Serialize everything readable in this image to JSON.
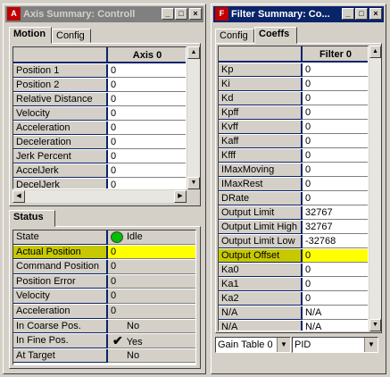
{
  "left_window": {
    "title": "Axis Summary: Controll",
    "motion_tabs": [
      "Motion",
      "Config"
    ],
    "motion_column_header": "Axis 0",
    "motion_rows": [
      {
        "label": "Position 1",
        "value": "0"
      },
      {
        "label": "Position 2",
        "value": "0"
      },
      {
        "label": "Relative Distance",
        "value": "0"
      },
      {
        "label": "Velocity",
        "value": "0"
      },
      {
        "label": "Acceleration",
        "value": "0"
      },
      {
        "label": "Deceleration",
        "value": "0"
      },
      {
        "label": "Jerk Percent",
        "value": "0"
      },
      {
        "label": "AccelJerk",
        "value": "0"
      },
      {
        "label": "DecelJerk",
        "value": "0"
      }
    ],
    "status_tab": "Status",
    "status_rows": [
      {
        "label": "State",
        "value": "Idle"
      },
      {
        "label": "Actual Position",
        "value": "0"
      },
      {
        "label": "Command Position",
        "value": "0"
      },
      {
        "label": "Position Error",
        "value": "0"
      },
      {
        "label": "Velocity",
        "value": "0"
      },
      {
        "label": "Acceleration",
        "value": "0"
      },
      {
        "label": "In Coarse Pos.",
        "value": "No"
      },
      {
        "label": "In Fine Pos.",
        "value": "Yes"
      },
      {
        "label": "At Target",
        "value": "No"
      }
    ],
    "state_indicator_color": "#00c000"
  },
  "right_window": {
    "title": "Filter Summary: Co...",
    "tabs": [
      "Config",
      "Coeffs"
    ],
    "column_header": "Filter 0",
    "rows": [
      {
        "label": "Kp",
        "value": "0"
      },
      {
        "label": "Ki",
        "value": "0"
      },
      {
        "label": "Kd",
        "value": "0"
      },
      {
        "label": "Kpff",
        "value": "0"
      },
      {
        "label": "Kvff",
        "value": "0"
      },
      {
        "label": "Kaff",
        "value": "0"
      },
      {
        "label": "Kfff",
        "value": "0"
      },
      {
        "label": "IMaxMoving",
        "value": "0"
      },
      {
        "label": "IMaxRest",
        "value": "0"
      },
      {
        "label": "DRate",
        "value": "0"
      },
      {
        "label": "Output Limit",
        "value": "32767"
      },
      {
        "label": "Output Limit High",
        "value": "32767"
      },
      {
        "label": "Output Limit Low",
        "value": "-32768"
      },
      {
        "label": "Output Offset",
        "value": "0"
      },
      {
        "label": "Ka0",
        "value": "0"
      },
      {
        "label": "Ka1",
        "value": "0"
      },
      {
        "label": "Ka2",
        "value": "0"
      },
      {
        "label": "N/A",
        "value": "N/A"
      },
      {
        "label": "N/A",
        "value": "N/A"
      },
      {
        "label": "N/A",
        "value": "N/A"
      }
    ],
    "gain_table_select": "Gain Table 0",
    "filter_type_select": "PID"
  },
  "colors": {
    "highlight_row": "#ffff00",
    "grid_line_accent": "#0a246a",
    "active_title": "#0a246a",
    "inactive_title": "#808080"
  }
}
